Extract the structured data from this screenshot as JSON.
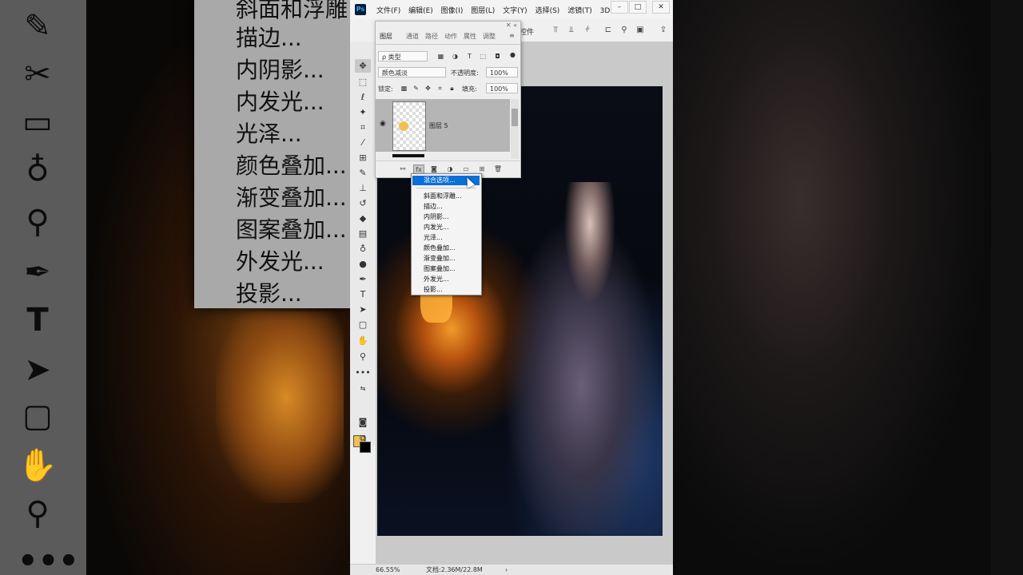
{
  "menubar": [
    "文件(F)",
    "编辑(E)",
    "图像(I)",
    "图层(L)",
    "文字(Y)",
    "选择(S)",
    "滤镜(T)",
    "3D"
  ],
  "options_bar": {
    "label": "控件"
  },
  "layers_panel": {
    "tabs": [
      "图层",
      "通道",
      "路径",
      "动作",
      "属性",
      "调整"
    ],
    "filter_type": "ρ 类型",
    "blend_mode": "颜色减淡",
    "opacity_label": "不透明度:",
    "opacity_value": "100%",
    "lock_label": "锁定:",
    "fill_label": "填充:",
    "fill_value": "100%",
    "layer_name": "图层 5",
    "fx_label": "fx"
  },
  "fx_menu": {
    "items": [
      "混合选项...",
      "斜面和浮雕...",
      "描边...",
      "内阴影...",
      "内发光...",
      "光泽...",
      "颜色叠加...",
      "渐变叠加...",
      "图案叠加...",
      "外发光...",
      "投影..."
    ],
    "highlighted_index": 0
  },
  "statusbar": {
    "zoom": "66.55%",
    "doc": "文档:2.36M/22.8M"
  },
  "background_menu": [
    "斜面和浮雕...",
    "描边...",
    "内阴影...",
    "内发光...",
    "光泽...",
    "颜色叠加...",
    "渐变叠加...",
    "图案叠加...",
    "外发光...",
    "投影..."
  ],
  "colors": {
    "foreground": "#f0c050",
    "background": "#000000",
    "menu_highlight": "#0a6fd6"
  }
}
